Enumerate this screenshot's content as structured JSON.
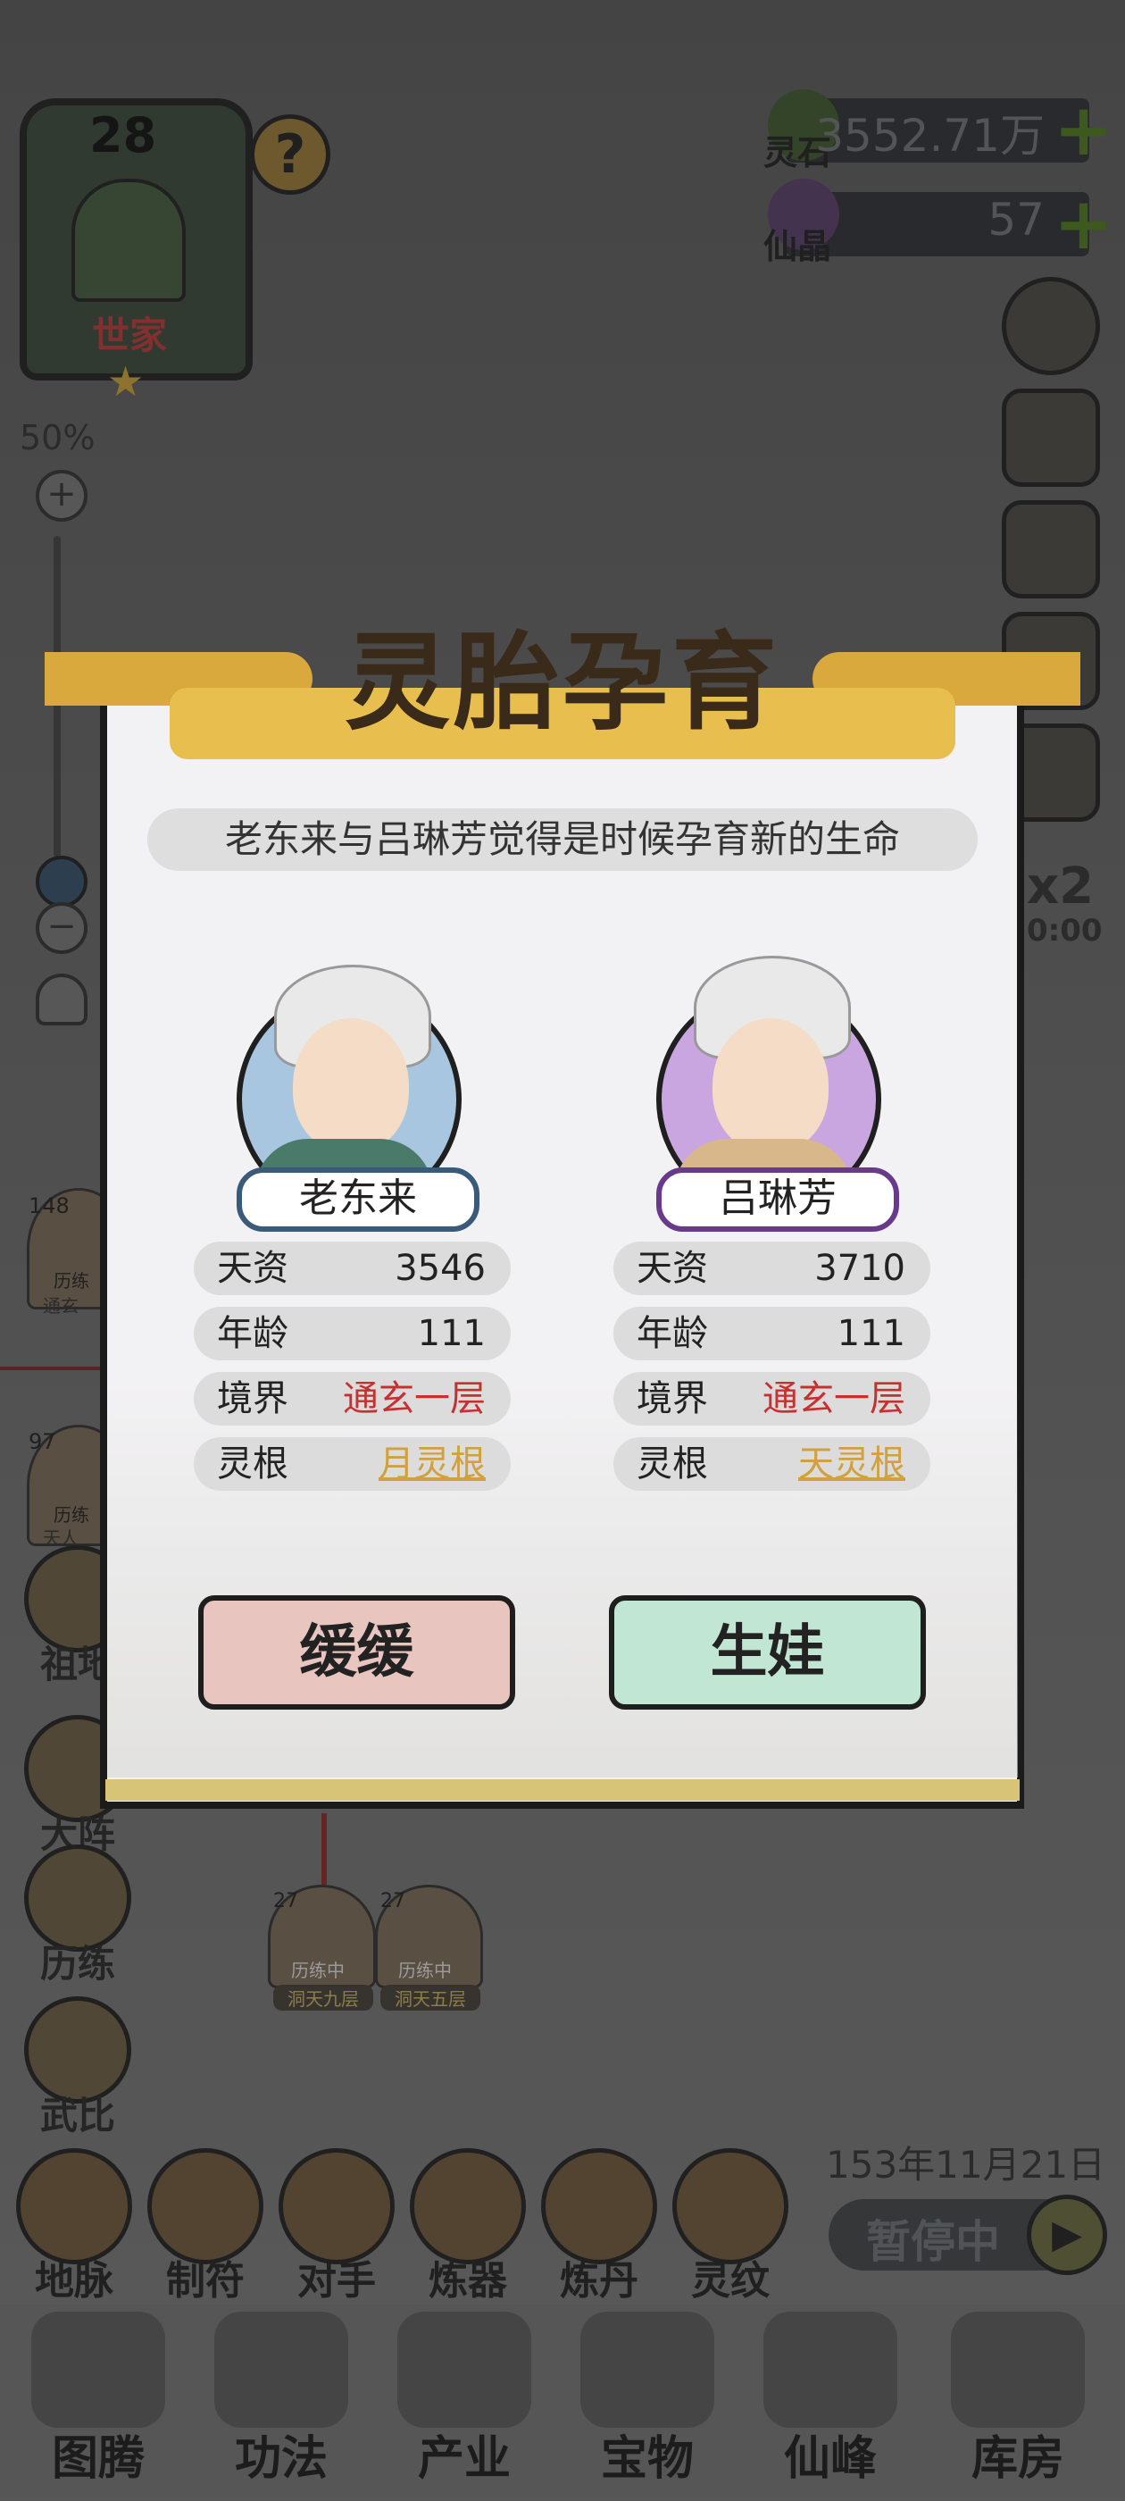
{
  "hud": {
    "clan_level": "28",
    "clan_title": "世家",
    "help": "?",
    "zoom_pct": "50%",
    "zoom_in": "+",
    "zoom_out": "−"
  },
  "resources": [
    {
      "label": "灵石",
      "value": "3552.71万"
    },
    {
      "label": "仙晶",
      "value": "57"
    }
  ],
  "speed": {
    "multiplier": "x2",
    "timer": "0:00"
  },
  "left_menu": [
    {
      "label": "祖地"
    },
    {
      "label": "大阵"
    },
    {
      "label": "历练"
    },
    {
      "label": "武比"
    }
  ],
  "tree_nodes": [
    {
      "badge": "148",
      "status": "历练",
      "realm": "通玄"
    },
    {
      "badge": "97",
      "status": "历练",
      "realm": "天人"
    }
  ],
  "child_nodes": [
    {
      "age": "27",
      "status": "历练中",
      "realm": "洞天九层"
    },
    {
      "age": "27",
      "status": "历练中",
      "realm": "洞天五层"
    }
  ],
  "toolbar": [
    {
      "label": "地脉"
    },
    {
      "label": "制符"
    },
    {
      "label": "对手"
    },
    {
      "label": "炼器"
    },
    {
      "label": "炼丹"
    },
    {
      "label": "灵纹"
    }
  ],
  "game_date": "153年11月21日",
  "pause_label": "暂停中",
  "bottom_nav": [
    {
      "label": "图腾"
    },
    {
      "label": "功法"
    },
    {
      "label": "产业"
    },
    {
      "label": "宝物"
    },
    {
      "label": "仙峰"
    },
    {
      "label": "库房"
    }
  ],
  "dialog": {
    "title": "灵胎孕育",
    "message": "老东来与吕琳芳觉得是时候孕育新的生命",
    "father": {
      "name": "老东来",
      "stats": [
        {
          "key": "天资",
          "value": "3546"
        },
        {
          "key": "年龄",
          "value": "111"
        },
        {
          "key": "境界",
          "value": "通玄一层"
        },
        {
          "key": "灵根",
          "value": "月灵根"
        }
      ]
    },
    "mother": {
      "name": "吕琳芳",
      "stats": [
        {
          "key": "天资",
          "value": "3710"
        },
        {
          "key": "年龄",
          "value": "111"
        },
        {
          "key": "境界",
          "value": "通玄一层"
        },
        {
          "key": "灵根",
          "value": "天灵根"
        }
      ]
    },
    "cancel_label": "缓缓",
    "confirm_label": "生娃"
  },
  "colors": {
    "realm_red": "#c73030",
    "root_gold": "#d1a040",
    "cancel_bg": "#e8c5be",
    "confirm_bg": "#c1e6d3",
    "banner_gold": "#e8bf4f"
  }
}
